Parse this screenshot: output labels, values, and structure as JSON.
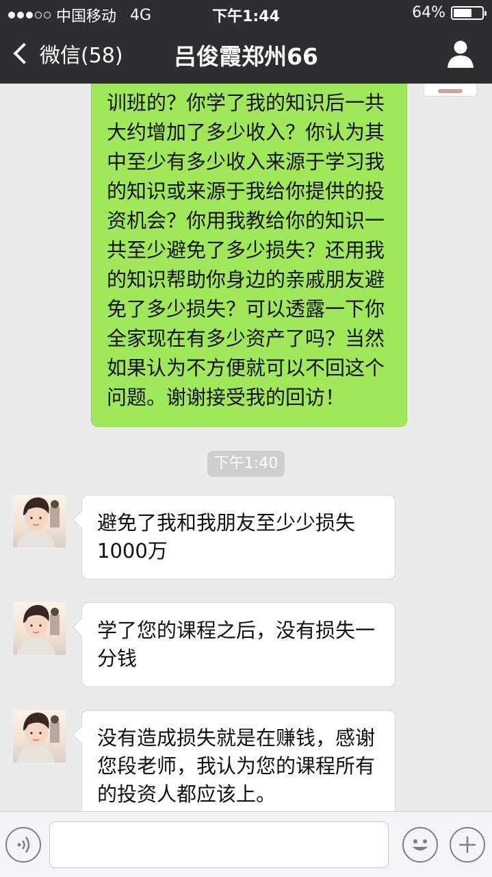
{
  "status_bar": {
    "carrier": "中国移动",
    "network": "4G",
    "time": "下午1:44",
    "battery_percent": "64%",
    "battery_level": 0.64,
    "signal_bars_filled": 3,
    "signal_bars_total": 5
  },
  "nav": {
    "back_label": "微信(58)",
    "title": "吕俊霞郑州66"
  },
  "messages": {
    "outgoing_1": "训班的？你学了我的知识后一共大约增加了多少收入？你认为其中至少有多少收入来源于学习我的知识或来源于我给你提供的投资机会？你用我教给你的知识一共至少避免了多少损失？还用我的知识帮助你身边的亲戚朋友避免了多少损失？可以透露一下你全家现在有多少资产了吗？当然如果认为不方便就可以不回这个问题。谢谢接受我的回访！",
    "timestamp": "下午1:40",
    "incoming_1": "避免了我和我朋友至少少损失1000万",
    "incoming_2": "学了您的课程之后，没有损失一分钱",
    "incoming_3": "没有造成损失就是在赚钱，感谢您段老师，我认为您的课程所有的投资人都应该上。"
  },
  "colors": {
    "nav_bg": "#2e2e31",
    "chat_bg": "#ebebeb",
    "outgoing_bubble": "#a0e75a",
    "incoming_bubble": "#ffffff"
  },
  "icons": [
    "back-chevron-icon",
    "profile-icon",
    "voice-icon",
    "emoji-icon",
    "plus-icon"
  ]
}
